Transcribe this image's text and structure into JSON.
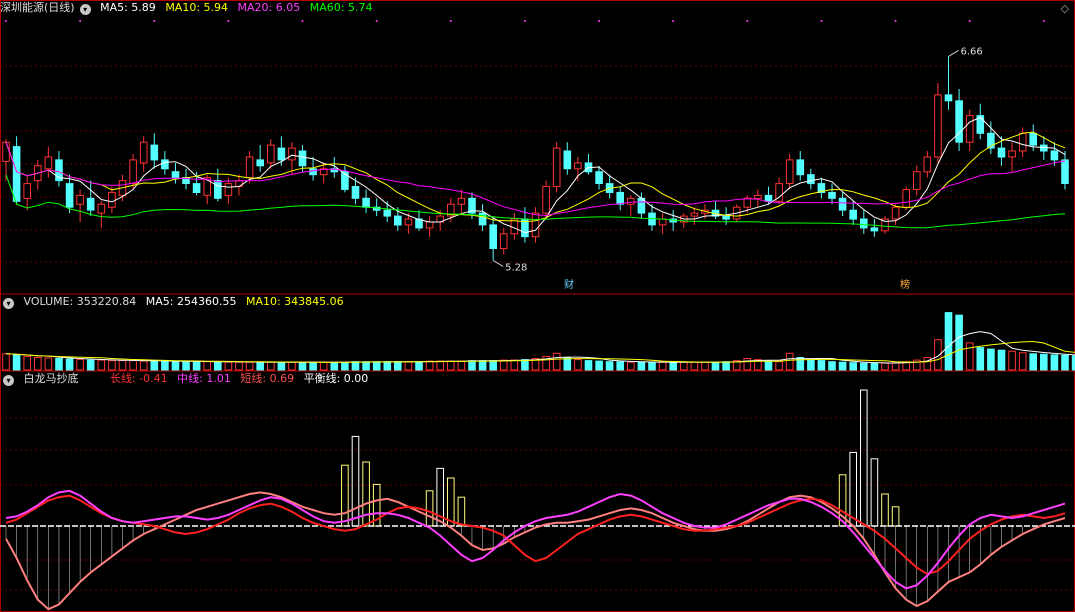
{
  "main_header": {
    "title": "深圳能源(日线)",
    "ma5": "MA5: 5.89",
    "ma10": "MA10: 5.94",
    "ma20": "MA20: 6.05",
    "ma60": "MA60: 5.74"
  },
  "volume_header": {
    "volume": "VOLUME: 353220.84",
    "ma5": "MA5: 254360.55",
    "ma10": "MA10: 343845.06"
  },
  "indicator_header": {
    "name": "白龙马抄底",
    "long_line": "长线: -0.41",
    "mid_line": "中线: 1.01",
    "short_line": "短线: 0.69",
    "balance_line": "平衡线: 0.00"
  },
  "badges": {
    "cai": "财",
    "bang": "榜"
  },
  "annotations": {
    "high": "6.66",
    "low": "5.28"
  },
  "colors": {
    "up": "#ff3232",
    "down": "#54ffff",
    "ma5": "#ffffff",
    "ma10": "#ffff00",
    "ma20": "#ff00ff",
    "ma60": "#00ff00",
    "long": "#ff3232",
    "mid": "#ff40ff",
    "short": "#ff8080",
    "balance": "#ffffff"
  },
  "chart_data": [
    {
      "type": "candlestick",
      "price_range": [
        5.1,
        6.9
      ],
      "high": 6.66,
      "low": 5.28,
      "ma": {
        "MA5": 5.89,
        "MA10": 5.94,
        "MA20": 6.05,
        "MA60": 5.74
      },
      "candles": [
        [
          5.95,
          6.1,
          5.82,
          6.08
        ],
        [
          6.05,
          6.12,
          5.66,
          5.68
        ],
        [
          5.7,
          5.85,
          5.62,
          5.8
        ],
        [
          5.82,
          5.96,
          5.76,
          5.92
        ],
        [
          5.9,
          6.05,
          5.84,
          5.98
        ],
        [
          5.96,
          6.02,
          5.78,
          5.82
        ],
        [
          5.8,
          5.86,
          5.6,
          5.64
        ],
        [
          5.66,
          5.76,
          5.54,
          5.72
        ],
        [
          5.7,
          5.82,
          5.58,
          5.62
        ],
        [
          5.6,
          5.68,
          5.5,
          5.66
        ],
        [
          5.64,
          5.78,
          5.6,
          5.74
        ],
        [
          5.72,
          5.86,
          5.68,
          5.82
        ],
        [
          5.8,
          6.0,
          5.76,
          5.96
        ],
        [
          5.94,
          6.12,
          5.88,
          6.08
        ],
        [
          6.06,
          6.14,
          5.9,
          5.96
        ],
        [
          5.96,
          6.02,
          5.86,
          5.9
        ],
        [
          5.88,
          5.94,
          5.8,
          5.84
        ],
        [
          5.84,
          5.9,
          5.76,
          5.8
        ],
        [
          5.8,
          5.88,
          5.72,
          5.74
        ],
        [
          5.72,
          5.86,
          5.66,
          5.84
        ],
        [
          5.82,
          5.9,
          5.68,
          5.7
        ],
        [
          5.72,
          5.84,
          5.66,
          5.8
        ],
        [
          5.78,
          5.86,
          5.72,
          5.82
        ],
        [
          5.84,
          6.02,
          5.8,
          5.98
        ],
        [
          5.96,
          6.06,
          5.88,
          5.92
        ],
        [
          5.94,
          6.1,
          5.9,
          6.06
        ],
        [
          6.04,
          6.12,
          5.92,
          5.96
        ],
        [
          5.96,
          6.08,
          5.86,
          6.04
        ],
        [
          6.02,
          6.06,
          5.88,
          5.92
        ],
        [
          5.9,
          5.98,
          5.82,
          5.86
        ],
        [
          5.86,
          5.94,
          5.8,
          5.9
        ],
        [
          5.9,
          5.98,
          5.84,
          5.88
        ],
        [
          5.88,
          5.92,
          5.74,
          5.76
        ],
        [
          5.78,
          5.84,
          5.66,
          5.7
        ],
        [
          5.7,
          5.76,
          5.6,
          5.64
        ],
        [
          5.64,
          5.7,
          5.58,
          5.62
        ],
        [
          5.62,
          5.68,
          5.54,
          5.58
        ],
        [
          5.58,
          5.64,
          5.48,
          5.52
        ],
        [
          5.52,
          5.6,
          5.46,
          5.56
        ],
        [
          5.56,
          5.62,
          5.48,
          5.5
        ],
        [
          5.5,
          5.58,
          5.44,
          5.54
        ],
        [
          5.54,
          5.62,
          5.48,
          5.58
        ],
        [
          5.58,
          5.7,
          5.54,
          5.66
        ],
        [
          5.66,
          5.76,
          5.6,
          5.7
        ],
        [
          5.7,
          5.74,
          5.56,
          5.6
        ],
        [
          5.6,
          5.66,
          5.48,
          5.52
        ],
        [
          5.52,
          5.58,
          5.28,
          5.36
        ],
        [
          5.36,
          5.5,
          5.32,
          5.46
        ],
        [
          5.46,
          5.6,
          5.42,
          5.56
        ],
        [
          5.56,
          5.64,
          5.4,
          5.44
        ],
        [
          5.44,
          5.64,
          5.4,
          5.6
        ],
        [
          5.6,
          5.82,
          5.56,
          5.78
        ],
        [
          5.78,
          6.08,
          5.74,
          6.04
        ],
        [
          6.02,
          6.08,
          5.86,
          5.9
        ],
        [
          5.9,
          5.98,
          5.82,
          5.94
        ],
        [
          5.94,
          6.0,
          5.86,
          5.88
        ],
        [
          5.88,
          5.92,
          5.76,
          5.8
        ],
        [
          5.8,
          5.86,
          5.7,
          5.74
        ],
        [
          5.74,
          5.78,
          5.62,
          5.66
        ],
        [
          5.66,
          5.72,
          5.58,
          5.7
        ],
        [
          5.7,
          5.74,
          5.56,
          5.6
        ],
        [
          5.6,
          5.66,
          5.48,
          5.52
        ],
        [
          5.52,
          5.6,
          5.46,
          5.56
        ],
        [
          5.56,
          5.62,
          5.48,
          5.54
        ],
        [
          5.54,
          5.6,
          5.5,
          5.58
        ],
        [
          5.58,
          5.64,
          5.52,
          5.6
        ],
        [
          5.6,
          5.66,
          5.56,
          5.62
        ],
        [
          5.62,
          5.68,
          5.56,
          5.58
        ],
        [
          5.58,
          5.64,
          5.52,
          5.56
        ],
        [
          5.56,
          5.66,
          5.54,
          5.64
        ],
        [
          5.64,
          5.72,
          5.6,
          5.7
        ],
        [
          5.7,
          5.76,
          5.64,
          5.72
        ],
        [
          5.72,
          5.78,
          5.66,
          5.68
        ],
        [
          5.68,
          5.84,
          5.66,
          5.8
        ],
        [
          5.8,
          6.0,
          5.76,
          5.96
        ],
        [
          5.96,
          6.02,
          5.82,
          5.86
        ],
        [
          5.86,
          5.9,
          5.76,
          5.8
        ],
        [
          5.8,
          5.84,
          5.7,
          5.74
        ],
        [
          5.74,
          5.8,
          5.66,
          5.7
        ],
        [
          5.7,
          5.74,
          5.58,
          5.62
        ],
        [
          5.62,
          5.68,
          5.52,
          5.56
        ],
        [
          5.56,
          5.62,
          5.46,
          5.5
        ],
        [
          5.5,
          5.56,
          5.44,
          5.48
        ],
        [
          5.48,
          5.58,
          5.46,
          5.56
        ],
        [
          5.56,
          5.66,
          5.52,
          5.64
        ],
        [
          5.64,
          5.78,
          5.62,
          5.76
        ],
        [
          5.76,
          5.92,
          5.72,
          5.88
        ],
        [
          5.88,
          6.02,
          5.84,
          5.98
        ],
        [
          5.98,
          6.48,
          5.94,
          6.4
        ],
        [
          6.4,
          6.66,
          6.3,
          6.36
        ],
        [
          6.36,
          6.44,
          6.02,
          6.08
        ],
        [
          6.08,
          6.3,
          6.02,
          6.26
        ],
        [
          6.26,
          6.34,
          6.1,
          6.14
        ],
        [
          6.14,
          6.22,
          6.0,
          6.04
        ],
        [
          6.04,
          6.12,
          5.92,
          5.98
        ],
        [
          5.98,
          6.08,
          5.88,
          6.02
        ],
        [
          6.02,
          6.18,
          5.98,
          6.14
        ],
        [
          6.14,
          6.2,
          6.02,
          6.06
        ],
        [
          6.06,
          6.12,
          5.96,
          6.02
        ],
        [
          6.02,
          6.08,
          5.92,
          5.96
        ],
        [
          5.96,
          6.02,
          5.76,
          5.8
        ]
      ]
    },
    {
      "type": "bar",
      "title": "VOLUME",
      "values": [
        3.1,
        2.9,
        2.6,
        2.4,
        2.3,
        2.2,
        2.1,
        2.0,
        1.9,
        1.9,
        1.8,
        1.8,
        1.8,
        1.7,
        1.7,
        1.7,
        1.6,
        1.6,
        1.6,
        1.6,
        1.6,
        1.5,
        1.5,
        1.5,
        1.5,
        1.5,
        1.5,
        1.5,
        1.5,
        1.5,
        1.5,
        1.5,
        1.5,
        1.6,
        1.6,
        1.6,
        1.6,
        1.6,
        1.6,
        1.6,
        1.7,
        1.7,
        1.7,
        1.7,
        1.8,
        1.8,
        1.8,
        1.9,
        1.9,
        2.0,
        2.2,
        2.6,
        3.2,
        2.4,
        2.0,
        1.8,
        1.7,
        1.6,
        1.6,
        1.5,
        1.5,
        1.5,
        1.5,
        1.5,
        1.5,
        1.5,
        1.5,
        1.5,
        1.6,
        1.8,
        2.2,
        2.0,
        1.7,
        1.6,
        3.2,
        2.4,
        2.0,
        1.8,
        1.6,
        1.5,
        1.4,
        1.3,
        1.3,
        1.3,
        1.4,
        1.6,
        1.9,
        2.4,
        5.8,
        11.0,
        10.5,
        5.2,
        4.3,
        4.0,
        3.8,
        3.6,
        3.3,
        3.1,
        3.0,
        2.9,
        2.8,
        2.7,
        3.1
      ]
    },
    {
      "type": "line",
      "title": "白龙马抄底",
      "series": [
        {
          "name": "长线",
          "values": [
            0.2,
            0.4,
            0.8,
            1.2,
            1.6,
            1.8,
            1.9,
            1.6,
            1.2,
            0.8,
            0.5,
            0.3,
            0.2,
            0.1,
            0.0,
            -0.2,
            -0.4,
            -0.5,
            -0.4,
            -0.2,
            0.1,
            0.4,
            0.8,
            1.1,
            1.3,
            1.4,
            1.2,
            0.9,
            0.5,
            0.2,
            0.0,
            -0.2,
            -0.3,
            -0.2,
            0.1,
            0.4,
            0.8,
            1.1,
            1.2,
            1.1,
            0.9,
            0.6,
            0.3,
            0.1,
            0.0,
            -0.1,
            -0.3,
            -0.6,
            -1.2,
            -1.8,
            -2.2,
            -2.0,
            -1.5,
            -1.0,
            -0.5,
            -0.2,
            0.1,
            0.4,
            0.6,
            0.7,
            0.6,
            0.4,
            0.2,
            0.0,
            -0.2,
            -0.3,
            -0.3,
            -0.2,
            -0.1,
            0.0,
            0.2,
            0.5,
            0.8,
            1.1,
            1.4,
            1.6,
            1.7,
            1.6,
            1.3,
            0.9,
            0.5,
            0.1,
            -0.3,
            -0.8,
            -1.4,
            -2.0,
            -2.6,
            -3.0,
            -2.8,
            -2.2,
            -1.5,
            -0.8,
            -0.3,
            0.1,
            0.4,
            0.6,
            0.7,
            0.6,
            0.5,
            0.6,
            0.8
          ]
        },
        {
          "name": "中线",
          "values": [
            0.5,
            0.6,
            0.9,
            1.3,
            1.8,
            2.1,
            2.2,
            1.9,
            1.4,
            0.9,
            0.5,
            0.3,
            0.2,
            0.3,
            0.4,
            0.5,
            0.6,
            0.6,
            0.5,
            0.4,
            0.5,
            0.7,
            1.0,
            1.3,
            1.6,
            1.8,
            1.7,
            1.4,
            1.0,
            0.6,
            0.3,
            0.2,
            0.3,
            0.5,
            0.7,
            0.8,
            0.8,
            0.7,
            0.5,
            0.2,
            -0.1,
            -0.6,
            -1.2,
            -1.8,
            -2.2,
            -2.0,
            -1.5,
            -0.9,
            -0.4,
            0.0,
            0.3,
            0.5,
            0.6,
            0.7,
            0.9,
            1.2,
            1.5,
            1.8,
            2.0,
            1.9,
            1.6,
            1.2,
            0.8,
            0.5,
            0.2,
            0.0,
            -0.1,
            -0.1,
            0.1,
            0.4,
            0.7,
            1.0,
            1.3,
            1.5,
            1.7,
            1.7,
            1.5,
            1.2,
            0.8,
            0.3,
            -0.4,
            -1.2,
            -2.0,
            -2.8,
            -3.5,
            -3.9,
            -3.7,
            -3.1,
            -2.3,
            -1.4,
            -0.6,
            0.1,
            0.5,
            0.7,
            0.6,
            0.5,
            0.6,
            0.8,
            1.0,
            1.2,
            1.4
          ]
        },
        {
          "name": "短线",
          "values": [
            -0.8,
            -2.0,
            -3.4,
            -4.6,
            -5.2,
            -4.9,
            -4.2,
            -3.5,
            -2.9,
            -2.4,
            -1.9,
            -1.4,
            -0.9,
            -0.5,
            -0.2,
            0.1,
            0.4,
            0.7,
            1.0,
            1.2,
            1.4,
            1.6,
            1.8,
            2.0,
            2.1,
            2.0,
            1.8,
            1.5,
            1.2,
            1.0,
            0.8,
            0.7,
            0.8,
            1.1,
            1.4,
            1.6,
            1.7,
            1.5,
            1.2,
            0.9,
            0.6,
            0.3,
            -0.1,
            -0.6,
            -1.2,
            -1.5,
            -1.4,
            -1.1,
            -0.7,
            -0.4,
            -0.1,
            0.1,
            0.2,
            0.2,
            0.3,
            0.4,
            0.6,
            0.8,
            1.0,
            1.1,
            1.0,
            0.8,
            0.5,
            0.2,
            0.0,
            -0.2,
            -0.3,
            -0.3,
            -0.2,
            0.0,
            0.3,
            0.7,
            1.1,
            1.5,
            1.8,
            1.9,
            1.8,
            1.5,
            1.1,
            0.6,
            0.0,
            -0.8,
            -1.8,
            -2.9,
            -3.9,
            -4.6,
            -5.0,
            -4.7,
            -4.1,
            -3.5,
            -3.2,
            -2.9,
            -2.4,
            -1.8,
            -1.3,
            -0.9,
            -0.5,
            -0.2,
            0.1,
            0.3,
            0.5
          ]
        },
        {
          "name": "平衡线",
          "values": [
            0.0
          ]
        }
      ],
      "bars_yellow": [
        0,
        0,
        0,
        0,
        0,
        0,
        0,
        0,
        0,
        0,
        0,
        0,
        0,
        0,
        0,
        0,
        0,
        0,
        0,
        0,
        0,
        0,
        0,
        0,
        0,
        0,
        0,
        0,
        0,
        0,
        0,
        0,
        0,
        0,
        0,
        0,
        0,
        0,
        0,
        0,
        0,
        0,
        0,
        0,
        0,
        0,
        0,
        0,
        0,
        0,
        0,
        0,
        0,
        0,
        0,
        0,
        0,
        0,
        0,
        0,
        0,
        0,
        0,
        0,
        0,
        0,
        0,
        0,
        0,
        0,
        0,
        0,
        0,
        0,
        0,
        0,
        0,
        0,
        0,
        0,
        0,
        0,
        0,
        0,
        0,
        0,
        0,
        0,
        0,
        0,
        0,
        0,
        0,
        0,
        0,
        0,
        0,
        0,
        0,
        0,
        0,
        0,
        0,
        0
      ],
      "bars_white": [
        0,
        0,
        0,
        0,
        0,
        0,
        0,
        0,
        0,
        0,
        0,
        0,
        0,
        0,
        0,
        0,
        0,
        0,
        0,
        0,
        0,
        0,
        0,
        0,
        0,
        0,
        0,
        0,
        0,
        0,
        0,
        0,
        0,
        0,
        0,
        0,
        0,
        0,
        0,
        0,
        0,
        0,
        0,
        0,
        0,
        0,
        0,
        0,
        0,
        0,
        0,
        0,
        0,
        0,
        0,
        0,
        0,
        0,
        0,
        0,
        0,
        0,
        0,
        0,
        0,
        0,
        0,
        0,
        0,
        0,
        0,
        0,
        0,
        0,
        0,
        0,
        0,
        0,
        0,
        0,
        0,
        0,
        0,
        0,
        0,
        0,
        0,
        0,
        0,
        0,
        0,
        0,
        0,
        0,
        0,
        0,
        0,
        0,
        0,
        0,
        0,
        0,
        0,
        0
      ]
    }
  ]
}
